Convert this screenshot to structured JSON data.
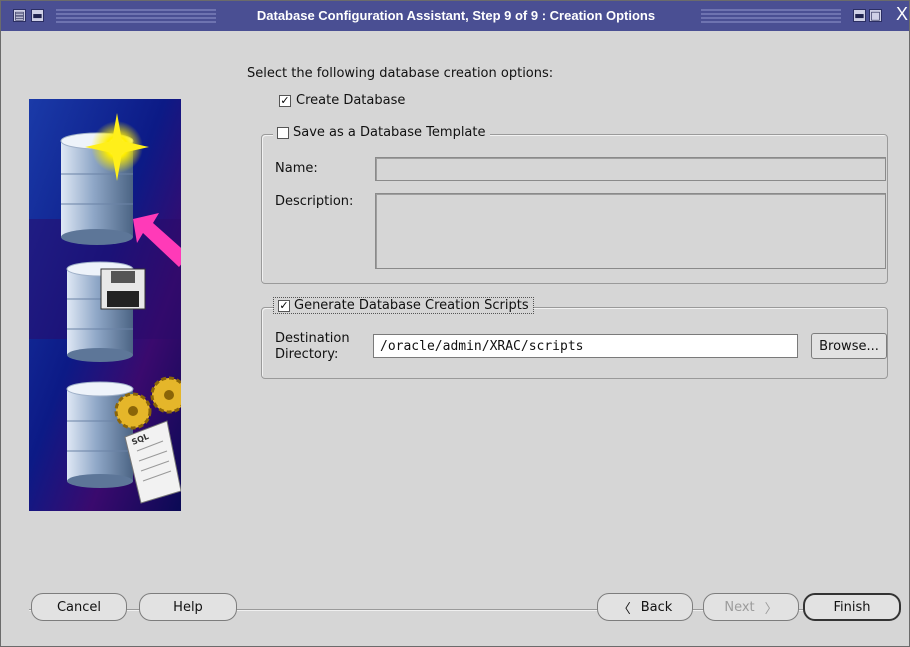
{
  "window": {
    "title": "Database Configuration Assistant, Step 9 of 9 : Creation Options",
    "close_glyph": "X"
  },
  "main": {
    "instruction": "Select the following database creation options:",
    "create_database": {
      "label": "Create Database",
      "checked": true
    },
    "template_group": {
      "label": "Save as a Database Template",
      "checked": false,
      "name_label": "Name:",
      "description_label": "Description:"
    },
    "scripts_group": {
      "label": "Generate Database Creation Scripts",
      "checked": true,
      "dest_label_line1": "Destination",
      "dest_label_line2": "Directory:",
      "dest_value": "/oracle/admin/XRAC/scripts",
      "browse_label": "Browse..."
    }
  },
  "footer": {
    "cancel_label": "Cancel",
    "help_label": "Help",
    "back_label": "Back",
    "next_label": "Next",
    "finish_label": "Finish"
  },
  "art": {
    "sql_scroll_text": "SQL"
  }
}
